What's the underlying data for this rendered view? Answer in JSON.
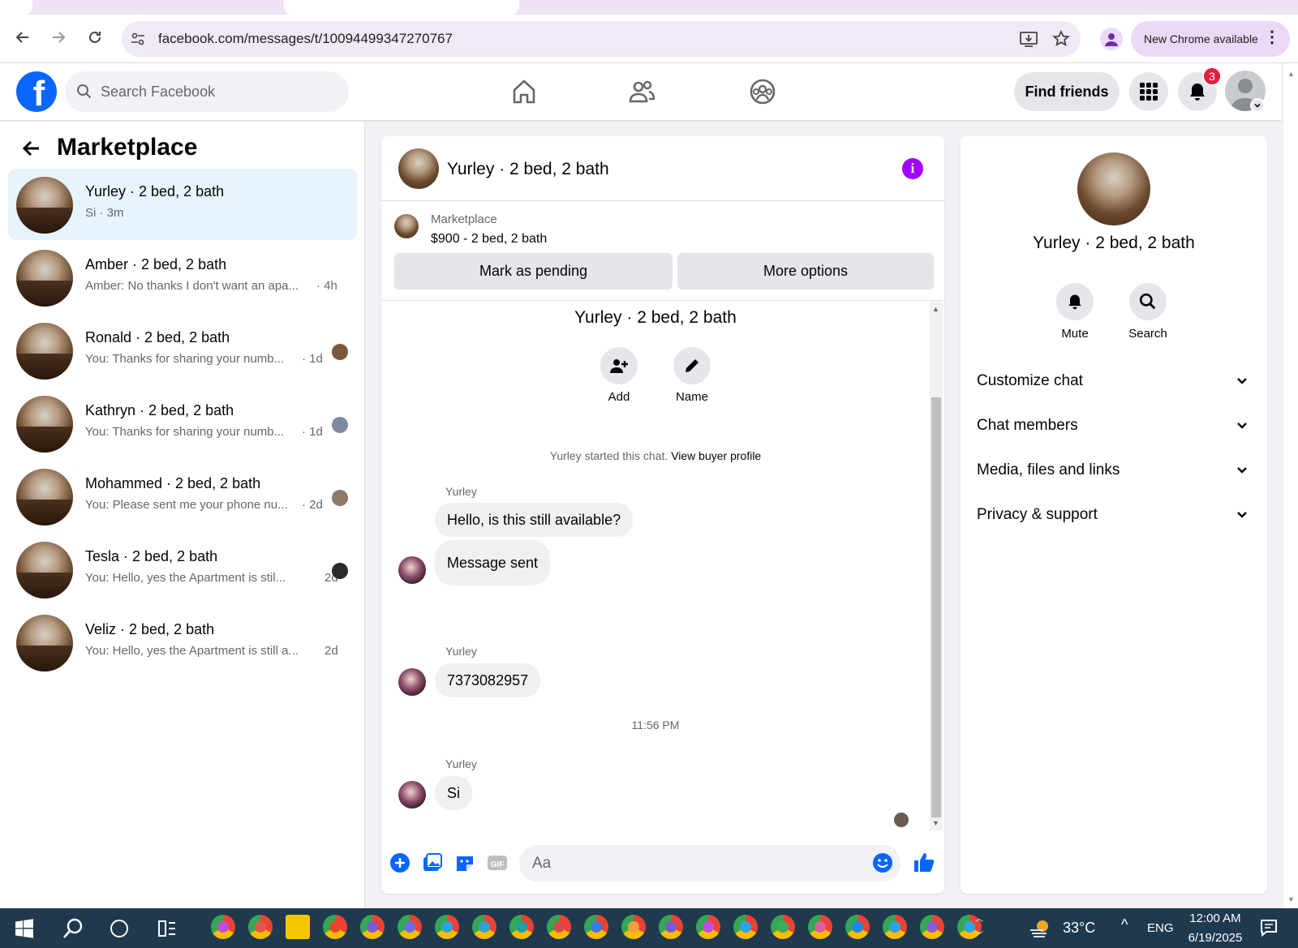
{
  "browser": {
    "url": "facebook.com/messages/t/10094499347270767",
    "new_chrome": "New Chrome available"
  },
  "fb": {
    "logo_letter": "f",
    "search_placeholder": "Search Facebook",
    "find_friends": "Find friends",
    "notification_count": "3"
  },
  "sidebar": {
    "title": "Marketplace",
    "conversations": [
      {
        "name": "Yurley · 2 bed, 2 bath",
        "preview": "Si · 3m",
        "time": "",
        "active": true
      },
      {
        "name": "Amber · 2 bed, 2 bath",
        "preview": "Amber: No thanks I don't want an apa...",
        "time": "· 4h"
      },
      {
        "name": "Ronald · 2 bed, 2 bath",
        "preview": "You: Thanks for sharing your numb...",
        "time": "· 1d"
      },
      {
        "name": "Kathryn · 2 bed, 2 bath",
        "preview": "You: Thanks for sharing your numb...",
        "time": "· 1d"
      },
      {
        "name": "Mohammed · 2 bed, 2 bath",
        "preview": "You: Please sent me your phone nu...",
        "time": "· 2d"
      },
      {
        "name": "Tesla · 2 bed, 2 bath",
        "preview": "You: Hello, yes the Apartment is stil...",
        "time": "2d"
      },
      {
        "name": "Veliz · 2 bed, 2 bath",
        "preview": "You: Hello, yes the Apartment is still a...",
        "time": "2d"
      }
    ]
  },
  "chat": {
    "title": "Yurley · 2 bed, 2 bath",
    "listing_label": "Marketplace",
    "listing_price": "$900 - 2 bed, 2 bath",
    "mark_pending": "Mark as pending",
    "more_options": "More options",
    "thread_name": "Yurley · 2 bed, 2 bath",
    "add_label": "Add",
    "name_label": "Name",
    "started_text": "Yurley started this chat.",
    "view_profile": "View buyer profile",
    "messages": [
      {
        "sender": "Yurley",
        "text": "Hello, is this still available?"
      },
      {
        "text": "Message sent"
      },
      {
        "sender": "Yurley",
        "text": "7373082957"
      },
      {
        "sender": "Yurley",
        "text": "Si"
      }
    ],
    "timestamp": "11:56 PM",
    "input_placeholder": "Aa"
  },
  "right_panel": {
    "name": "Yurley · 2 bed, 2 bath",
    "mute": "Mute",
    "search": "Search",
    "sections": [
      "Customize chat",
      "Chat members",
      "Media, files and links",
      "Privacy & support"
    ]
  },
  "taskbar": {
    "temperature": "33°C",
    "language": "ENG",
    "time": "12:00 AM",
    "date": "6/19/2025"
  },
  "colors": {
    "fb_blue": "#0866ff",
    "info_purple": "#a200ff",
    "badge_red": "#e41e3f"
  }
}
